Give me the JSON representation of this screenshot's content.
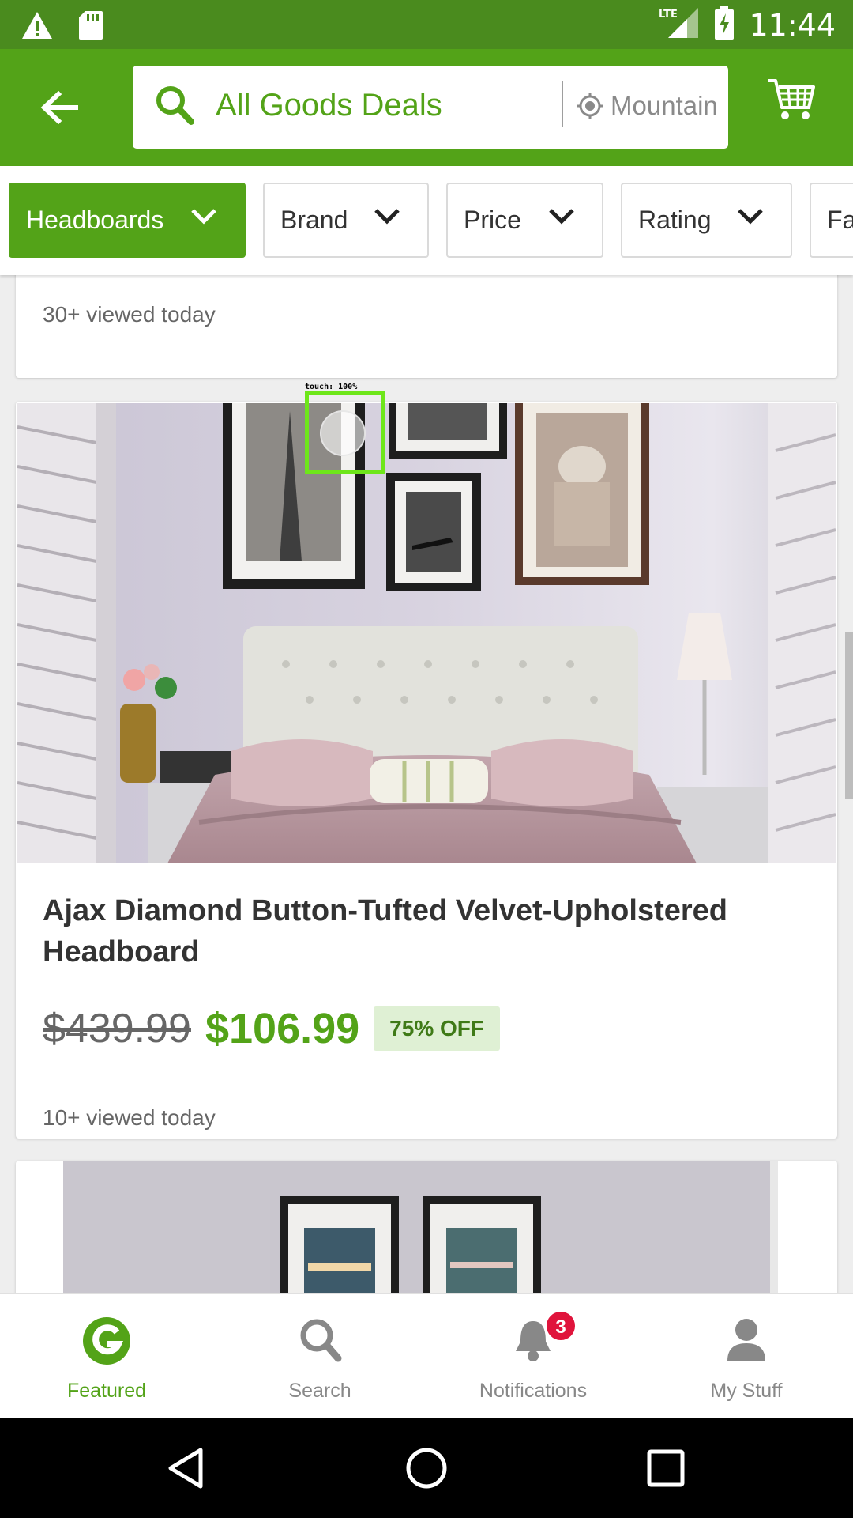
{
  "status_bar": {
    "time": "11:44",
    "network": "LTE",
    "icons": [
      "alert-icon",
      "sd-card-icon",
      "signal-icon",
      "battery-charging-icon"
    ]
  },
  "app_bar": {
    "search_query": "All Goods Deals",
    "location": "Mountain View",
    "icons": [
      "back-arrow-icon",
      "search-icon",
      "location-icon",
      "cart-icon"
    ]
  },
  "filters": [
    {
      "label": "Headboards",
      "active": true
    },
    {
      "label": "Brand",
      "active": false
    },
    {
      "label": "Price",
      "active": false
    },
    {
      "label": "Rating",
      "active": false
    },
    {
      "label": "Fa",
      "active": false
    }
  ],
  "cards": {
    "previous": {
      "views": "30+ viewed today"
    },
    "main": {
      "title": "Ajax Diamond Button-Tufted Velvet-Upholstered Headboard",
      "old_price": "$439.99",
      "new_price": "$106.99",
      "discount": "75% OFF",
      "views": "10+ viewed today"
    }
  },
  "touch_overlay": {
    "label": "touch: 100%"
  },
  "bottom_nav": [
    {
      "label": "Featured",
      "icon": "groupon-g-icon",
      "active": true
    },
    {
      "label": "Search",
      "icon": "search-icon",
      "active": false
    },
    {
      "label": "Notifications",
      "icon": "bell-icon",
      "active": false,
      "badge": "3"
    },
    {
      "label": "My Stuff",
      "icon": "person-icon",
      "active": false
    }
  ],
  "colors": {
    "brand_green": "#53a318",
    "status_green": "#4a8b1e",
    "badge_red": "#e0143c",
    "discount_bg": "#dff0d4"
  }
}
